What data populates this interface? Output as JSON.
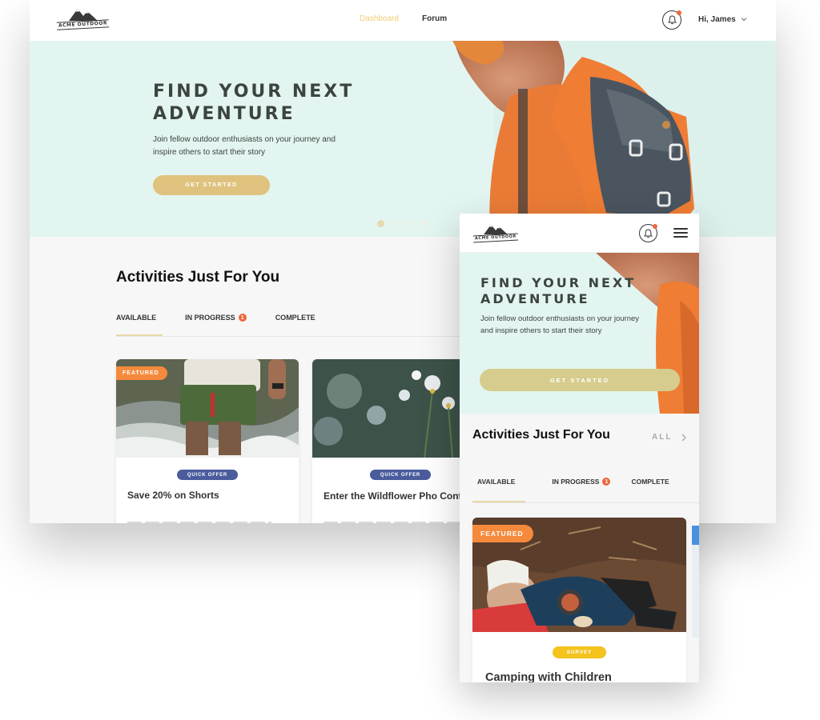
{
  "brand": {
    "logo_text": "ACME OUTDOOR"
  },
  "desktop": {
    "nav": {
      "items": [
        {
          "label": "Dashboard"
        },
        {
          "label": "Forum"
        }
      ],
      "user_label": "Hi, James"
    },
    "hero": {
      "title": "FIND YOUR NEXT ADVENTURE",
      "subtitle": "Join fellow outdoor enthusiasts on your journey and inspire others to start their story",
      "cta": "GET STARTED",
      "carousel": {
        "slides": 4,
        "active": 1
      }
    },
    "section_title": "Activities Just For You",
    "tabs": [
      {
        "label": "AVAILABLE"
      },
      {
        "label": "IN PROGRESS",
        "badge": "1"
      },
      {
        "label": "COMPLETE"
      }
    ],
    "cards": [
      {
        "flag": "FEATURED",
        "tag": "QUICK OFFER",
        "title": "Save 20% on Shorts"
      },
      {
        "tag": "QUICK OFFER",
        "title": "Enter the Wildflower Pho Contest"
      }
    ]
  },
  "mobile": {
    "hero": {
      "title": "FIND YOUR NEXT ADVENTURE",
      "subtitle": "Join fellow outdoor enthusiasts on your journey and inspire others to start their story",
      "cta": "GET STARTED"
    },
    "section_title": "Activities Just For You",
    "all_link": "ALL",
    "tabs": [
      {
        "label": "AVAILABLE"
      },
      {
        "label": "IN PROGRESS",
        "badge": "1"
      },
      {
        "label": "COMPLETE"
      }
    ],
    "card": {
      "flag": "FEATURED",
      "tag": "SURVEY",
      "title": "Camping with Children"
    }
  },
  "colors": {
    "accent_gold": "#dfc27d",
    "hero_bg": "#e3f5f1",
    "featured_orange": "#f58a3c",
    "badge_red": "#f0663d",
    "quick_offer_blue": "#4a5c9c",
    "survey_yellow": "#f4c31c"
  },
  "icons": [
    "mountain-logo-icon",
    "bell-icon",
    "chevron-down-icon",
    "hamburger-menu-icon",
    "chevron-right-icon"
  ]
}
